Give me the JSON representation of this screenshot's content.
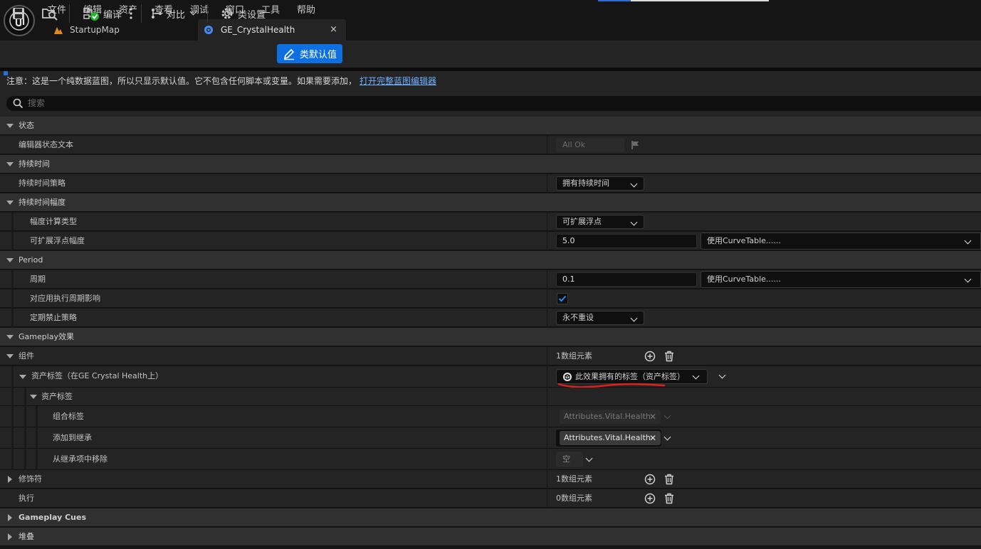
{
  "menu": [
    "文件",
    "编辑",
    "资产",
    "查看",
    "调试",
    "窗口",
    "工具",
    "帮助"
  ],
  "tabs": [
    {
      "label": "StartupMap"
    },
    {
      "label": "GE_CrystalHealth",
      "close": "×"
    }
  ],
  "toolbar": {
    "compile_label": "编译",
    "diff_label": "对比",
    "class_settings_label": "类设置",
    "class_defaults_label": "类默认值"
  },
  "notice": {
    "text": "注意：这是一个纯数据蓝图，所以只显示默认值。它不包含任何脚本或变量。如果需要添加，",
    "link": "打开完整蓝图编辑器"
  },
  "search": {
    "placeholder": "搜索"
  },
  "colors": {
    "accent": "#0e70e0",
    "annotation": "#e0201c",
    "background": "#242424",
    "category": "#303030"
  },
  "details": {
    "status": {
      "category": "状态",
      "editor_status_text": {
        "label": "编辑器状态文本",
        "value": "All Ok"
      }
    },
    "duration": {
      "category": "持续时间",
      "policy": {
        "label": "持续时间策略",
        "value": "拥有持续时间"
      }
    },
    "duration_magnitude": {
      "category": "持续时间幅度",
      "calc_type": {
        "label": "幅度计算类型",
        "value": "可扩展浮点"
      },
      "scalable_float": {
        "label": "可扩展浮点幅度",
        "value": "5.0",
        "curve": "使用CurveTable......"
      }
    },
    "period": {
      "category": "Period",
      "period": {
        "label": "周期",
        "value": "0.1",
        "curve": "使用CurveTable......"
      },
      "execute_on_apply": {
        "label": "对应用执行周期影响",
        "checked": true
      },
      "inhibition": {
        "label": "定期禁止策略",
        "value": "永不重设"
      }
    },
    "gameplay_effect": {
      "category": "Gameplay效果",
      "components": {
        "label": "组件",
        "value": "1数组元素"
      },
      "asset_tags_comp": {
        "label": "资产标签（在GE Crystal Health上）",
        "value": "此效果拥有的标签（资产标签）"
      },
      "asset_tags": {
        "label": "资产标签"
      },
      "combined": {
        "label": "组合标签",
        "tag": "Attributes.Vital.Health",
        "x": "✕"
      },
      "add_inherited": {
        "label": "添加到继承",
        "tag": "Attributes.Vital.Health",
        "x": "✕"
      },
      "remove_inherited": {
        "label": "从继承项中移除",
        "value": "空"
      },
      "modifiers": {
        "label": "修饰符",
        "value": "1数组元素"
      },
      "executions": {
        "label": "执行",
        "value": "0数组元素"
      }
    },
    "gameplay_cues": {
      "category": "Gameplay Cues"
    },
    "stacking": {
      "category": "堆叠"
    }
  }
}
